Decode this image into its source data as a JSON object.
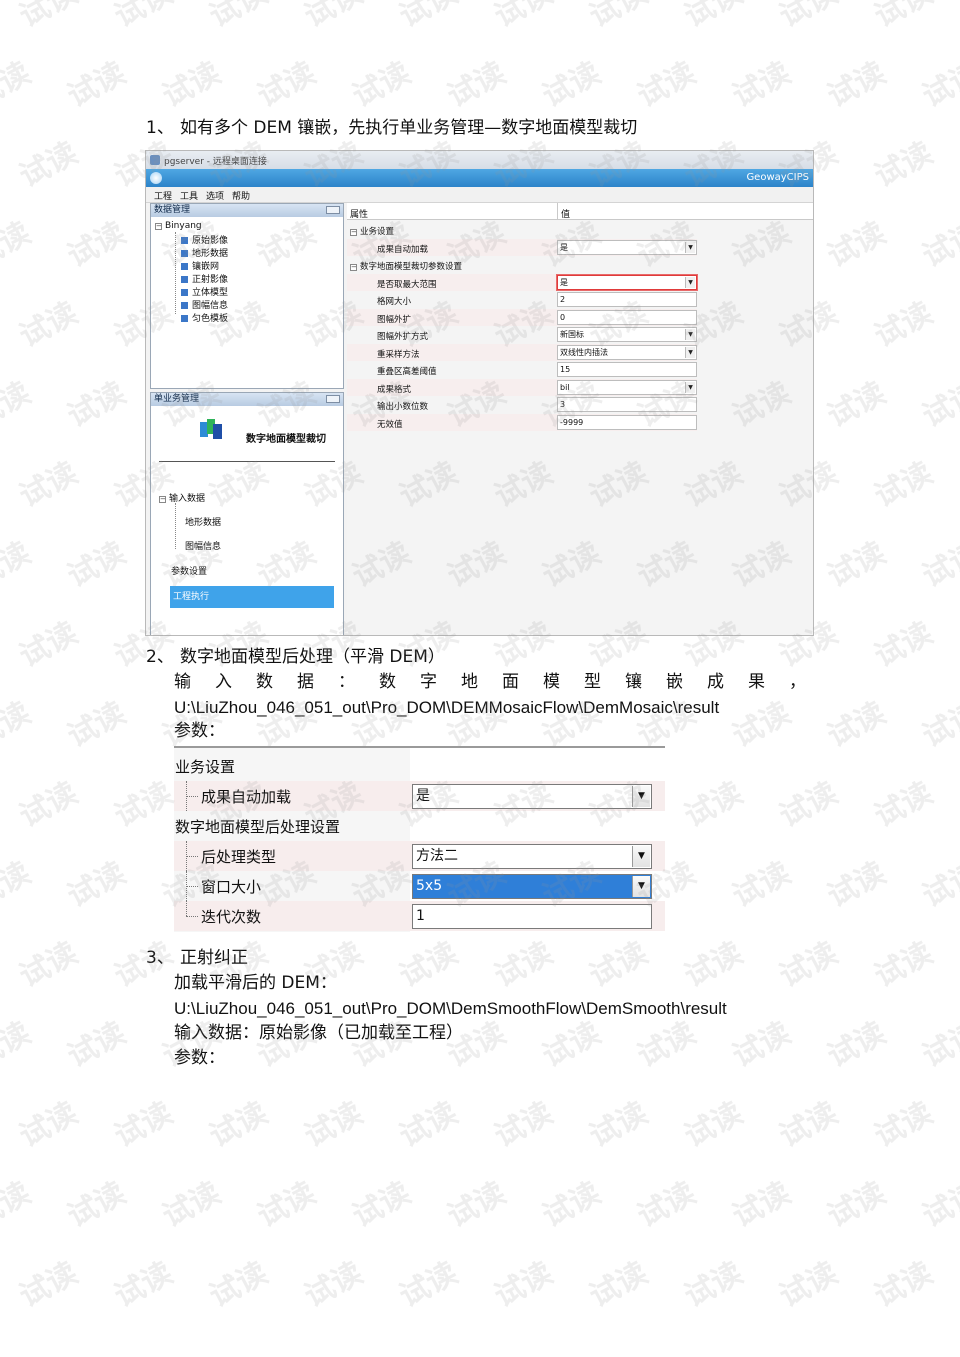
{
  "watermark": "试读",
  "section1": {
    "number": "1、",
    "text": "如有多个 DEM 镶嵌，先执行单业务管理—数字地面模型裁切"
  },
  "screenshot1": {
    "window_title": "pgserver - 远程桌面连接",
    "brand": "GeowayCIPS",
    "menu": [
      "工程",
      "工具",
      "选项",
      "帮助"
    ],
    "data_panel": {
      "title": "数据管理",
      "root": "Binyang",
      "items": [
        "原始影像",
        "地形数据",
        "镶嵌网",
        "正射影像",
        "立体模型",
        "图幅信息",
        "匀色模板"
      ]
    },
    "task_panel": {
      "title": "单业务管理",
      "wizard_title": "数字地面模型裁切",
      "input_group": "输入数据",
      "input_items": [
        "地形数据",
        "图幅信息"
      ],
      "param_item": "参数设置",
      "active_item": "工程执行"
    },
    "props": {
      "col_property": "属性",
      "col_value": "值",
      "group1": "业务设置",
      "group2": "数字地面模型裁切参数设置",
      "rows": [
        {
          "label": "成果自动加载",
          "value": "是",
          "dropdown": true
        },
        {
          "label": "是否取最大范围",
          "value": "是",
          "dropdown": true
        },
        {
          "label": "格网大小",
          "value": "2",
          "dropdown": false
        },
        {
          "label": "图幅外扩",
          "value": "0",
          "dropdown": false
        },
        {
          "label": "图幅外扩方式",
          "value": "新国标",
          "dropdown": true
        },
        {
          "label": "重采样方法",
          "value": "双线性内插法",
          "dropdown": true
        },
        {
          "label": "重叠区高差阈值",
          "value": "15",
          "dropdown": false
        },
        {
          "label": "成果格式",
          "value": "bil",
          "dropdown": true
        },
        {
          "label": "输出小数位数",
          "value": "3",
          "dropdown": false
        },
        {
          "label": "无效值",
          "value": "-9999",
          "dropdown": false
        }
      ]
    }
  },
  "section2": {
    "number": "2、",
    "title": "数字地面模型后处理（平滑 DEM）",
    "input_label_chars": [
      "输",
      "入",
      "数",
      "据",
      "：",
      "数",
      "字",
      "地",
      "面",
      "模",
      "型",
      "镶",
      "嵌",
      "成",
      "果",
      "，"
    ],
    "input_path": "U:\\LiuZhou_046_051_out\\Pro_DOM\\DEMMosaicFlow\\DemMosaic\\result",
    "params_label": "参数："
  },
  "screenshot2": {
    "group1": "业务设置",
    "row1": {
      "label": "成果自动加载",
      "value": "是"
    },
    "group2": "数字地面模型后处理设置",
    "row2": {
      "label": "后处理类型",
      "value": "方法二"
    },
    "row3": {
      "label": "窗口大小",
      "value": "5x5"
    },
    "row4": {
      "label": "迭代次数",
      "value": "1"
    }
  },
  "section3": {
    "number": "3、",
    "title": "正射纠正",
    "line1": "加载平滑后的 DEM：",
    "path": "U:\\LiuZhou_046_051_out\\Pro_DOM\\DemSmoothFlow\\DemSmooth\\result",
    "line3": "输入数据：原始影像（已加载至工程）",
    "line4": "参数："
  }
}
